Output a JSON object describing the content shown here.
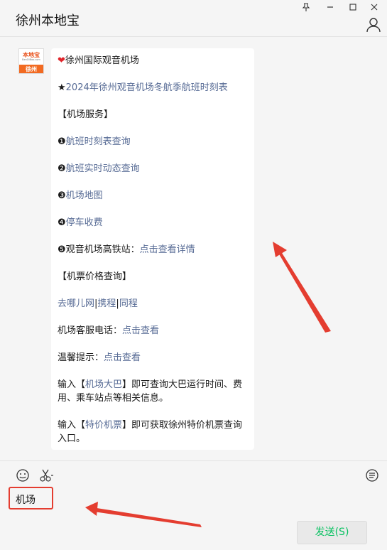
{
  "window": {
    "title": "徐州本地宝",
    "pin_glyph": "⊥",
    "minimize_glyph": "—",
    "maximize_glyph": "☐",
    "close_glyph": "✕"
  },
  "avatar": {
    "brand": "本地宝",
    "site": "BenDiBao.com",
    "city": "徐州"
  },
  "message": {
    "heading_icon": "❤",
    "heading": "徐州国际观音机场",
    "schedule_star": "★",
    "schedule_link": "2024年徐州观音机场冬航季航班时刻表",
    "services_header": "【机场服务】",
    "items": [
      {
        "num": "❶",
        "link": "航班时刻表查询"
      },
      {
        "num": "❷",
        "link": "航班实时动态查询"
      },
      {
        "num": "❸",
        "link": "机场地图"
      },
      {
        "num": "❹",
        "link": "停车收费"
      }
    ],
    "item5_num": "❺",
    "item5_text": "观音机场高铁站：",
    "item5_link": "点击查看详情",
    "price_header": "【机票价格查询】",
    "price_links": [
      "去哪儿网",
      "携程",
      "同程"
    ],
    "price_sep": "|",
    "phone_text": "机场客服电话：",
    "phone_link": "点击查看",
    "tip_text": "温馨提示：",
    "tip_link": "点击查看",
    "bus_pre": "输入【",
    "bus_link": "机场大巴",
    "bus_post": "】即可查询大巴运行时间、费用、乘车站点等相关信息。",
    "ticket_pre": "输入【",
    "ticket_link": "特价机票",
    "ticket_post": "】即可获取徐州特价机票查询入口。"
  },
  "input": {
    "value": "机场",
    "send_label": "发送(S)"
  },
  "colors": {
    "link": "#576b95",
    "accent_red": "#e43d30",
    "send_green": "#07c160"
  }
}
